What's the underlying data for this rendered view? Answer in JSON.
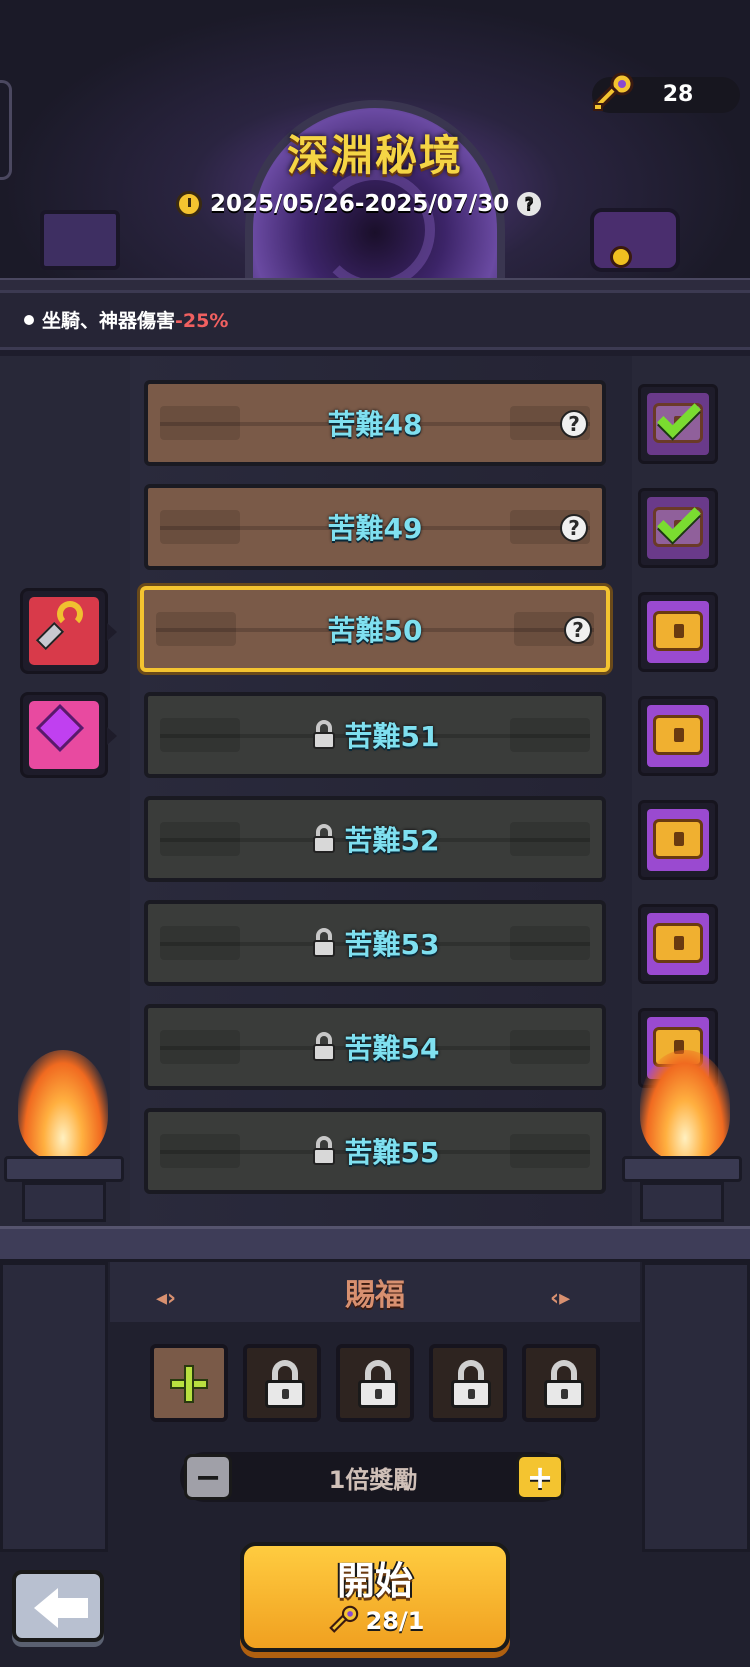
{
  "header": {
    "title": "深淵秘境",
    "date_range": "2025/05/26-2025/07/30",
    "help_symbol": "?",
    "key_count": "28"
  },
  "effect": {
    "prefix": "坐騎、神器傷害",
    "value": "-25%",
    "value_color": "#f06060"
  },
  "levels": [
    {
      "label": "苦難48",
      "state": "cleared"
    },
    {
      "label": "苦難49",
      "state": "cleared"
    },
    {
      "label": "苦難50",
      "state": "current"
    },
    {
      "label": "苦難51",
      "state": "locked"
    },
    {
      "label": "苦難52",
      "state": "locked"
    },
    {
      "label": "苦難53",
      "state": "locked"
    },
    {
      "label": "苦難54",
      "state": "locked"
    },
    {
      "label": "苦難55",
      "state": "locked"
    }
  ],
  "level_rewards": [
    {
      "level": "苦難50",
      "icon": "hammer-horseshoe-icon"
    },
    {
      "level": "苦難51",
      "icon": "pink-crystal-icon"
    }
  ],
  "blessing": {
    "title": "賜福",
    "slots": [
      "add",
      "locked",
      "locked",
      "locked",
      "locked"
    ]
  },
  "multiplier": {
    "label": "1倍獎勵",
    "minus": "−",
    "plus": "+"
  },
  "start": {
    "label": "開始",
    "cost": "28/1"
  },
  "colors": {
    "accent_gold": "#f4c430",
    "level_text": "#7fe0f0",
    "chest_purple": "#9a4ad0"
  }
}
